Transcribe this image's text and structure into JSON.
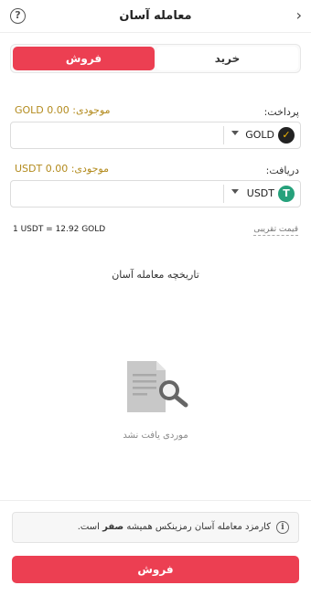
{
  "header": {
    "title": "معامله آسان",
    "help": "?",
    "back": "›"
  },
  "tabs": [
    {
      "label": "فروش",
      "active": true
    },
    {
      "label": "خرید",
      "active": false
    }
  ],
  "pay": {
    "label": "پرداخت:",
    "balance": "موجودی: 0.00 GOLD",
    "currency": "GOLD",
    "icon": "gold-coin-icon",
    "value": ""
  },
  "receive": {
    "label": "دریافت:",
    "balance": "موجودی: 0.00 USDT",
    "currency": "USDT",
    "icon": "usdt-tether-icon",
    "value": ""
  },
  "rate": {
    "value": "1 USDT = 12.92 GOLD",
    "label": "قیمت تقریبی"
  },
  "history": {
    "title": "تاریخچه معامله آسان",
    "empty_text": "موردی یافت نشد",
    "empty_icon": "document-search-icon"
  },
  "notice": {
    "prefix": "کارمزد معامله آسان رمزینکس همیشه",
    "highlight": "صفر",
    "suffix": "است.",
    "icon": "info-icon"
  },
  "submit_label": "فروش",
  "colors": {
    "primary": "#ec3f52",
    "balance": "#b38b1e",
    "usdt": "#26a17b"
  }
}
